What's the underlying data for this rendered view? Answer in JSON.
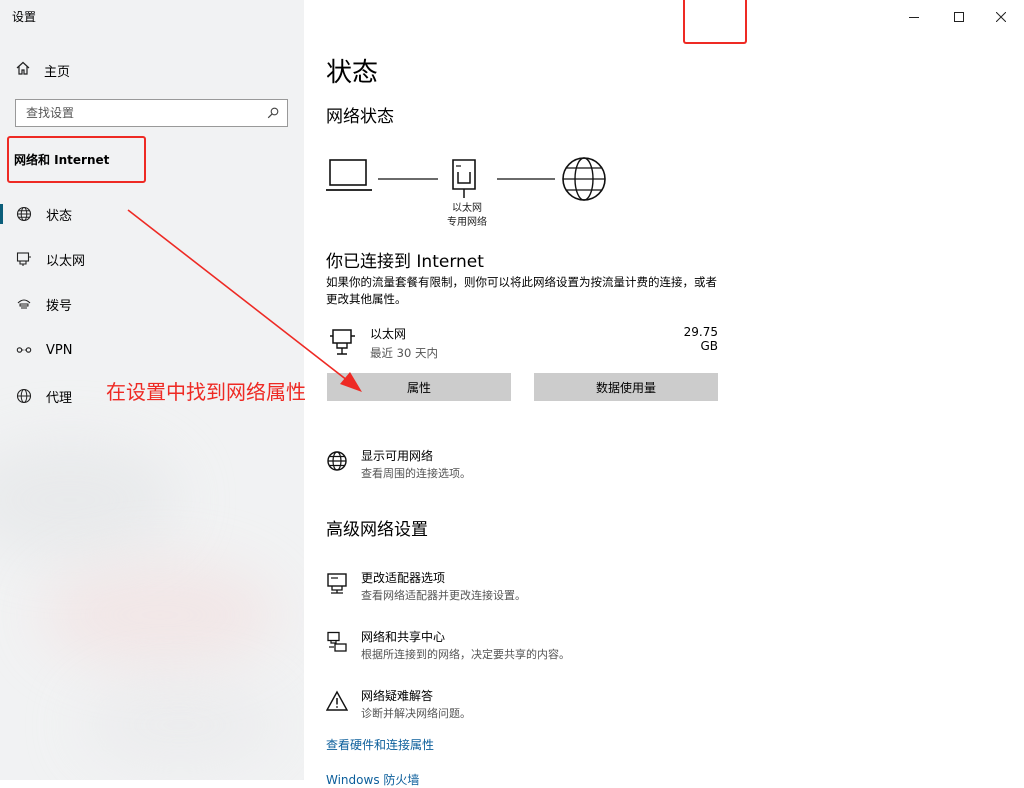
{
  "sidebar": {
    "app_title": "设置",
    "home_label": "主页",
    "search_placeholder": "查找设置",
    "section_title": "网络和 Internet",
    "items": [
      {
        "label": "状态",
        "icon": "globe-icon"
      },
      {
        "label": "以太网",
        "icon": "ethernet-icon"
      },
      {
        "label": "拨号",
        "icon": "dialup-icon"
      },
      {
        "label": "VPN",
        "icon": "vpn-icon"
      },
      {
        "label": "代理",
        "icon": "globe-icon"
      }
    ]
  },
  "annotation": {
    "text": "在设置中找到网络属性",
    "color": "#ee2a24"
  },
  "main": {
    "page_title": "状态",
    "network_status_title": "网络状态",
    "diagram": {
      "label_line1": "以太网",
      "label_line2": "专用网络"
    },
    "connected_title": "你已连接到 Internet",
    "connected_desc": "如果你的流量套餐有限制，则你可以将此网络设置为按流量计费的连接，或者更改其他属性。",
    "connection": {
      "name": "以太网",
      "sub": "最近 30 天内",
      "usage": "29.75 GB"
    },
    "buttons": {
      "properties": "属性",
      "data_usage": "数据使用量"
    },
    "show_networks": {
      "title": "显示可用网络",
      "desc": "查看周围的连接选项。"
    },
    "advanced_title": "高级网络设置",
    "advanced": [
      {
        "title": "更改适配器选项",
        "desc": "查看网络适配器并更改连接设置。",
        "icon": "adapter-icon"
      },
      {
        "title": "网络和共享中心",
        "desc": "根据所连接到的网络，决定要共享的内容。",
        "icon": "sharing-icon"
      },
      {
        "title": "网络疑难解答",
        "desc": "诊断并解决网络问题。",
        "icon": "warning-icon"
      }
    ],
    "links": [
      "查看硬件和连接属性",
      "Windows 防火墙"
    ]
  },
  "colors": {
    "accent": "#0b5e7a",
    "link": "#0b5e9b",
    "button_bg": "#cccccc"
  }
}
